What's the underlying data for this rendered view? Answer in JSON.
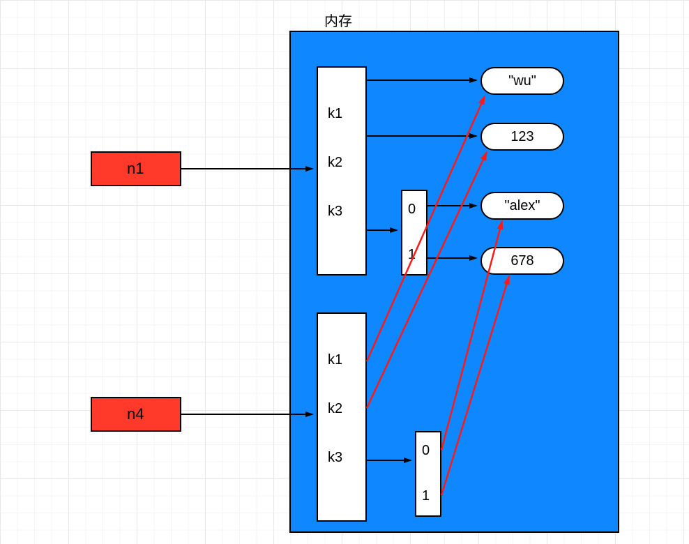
{
  "title": "内存",
  "variables": {
    "n1": {
      "label": "n1"
    },
    "n4": {
      "label": "n4"
    }
  },
  "dict_keys": {
    "k1": "k1",
    "k2": "k2",
    "k3": "k3"
  },
  "list_indices": {
    "i0": "0",
    "i1": "1"
  },
  "values": {
    "v_wu": "\"wu\"",
    "v_123": "123",
    "v_alex": "\"alex\"",
    "v_678": "678"
  },
  "colors": {
    "memory_bg": "#0e87ff",
    "var_bg": "#ff3a2a",
    "arrow_black": "#000000",
    "arrow_red": "#ff1a1a"
  }
}
